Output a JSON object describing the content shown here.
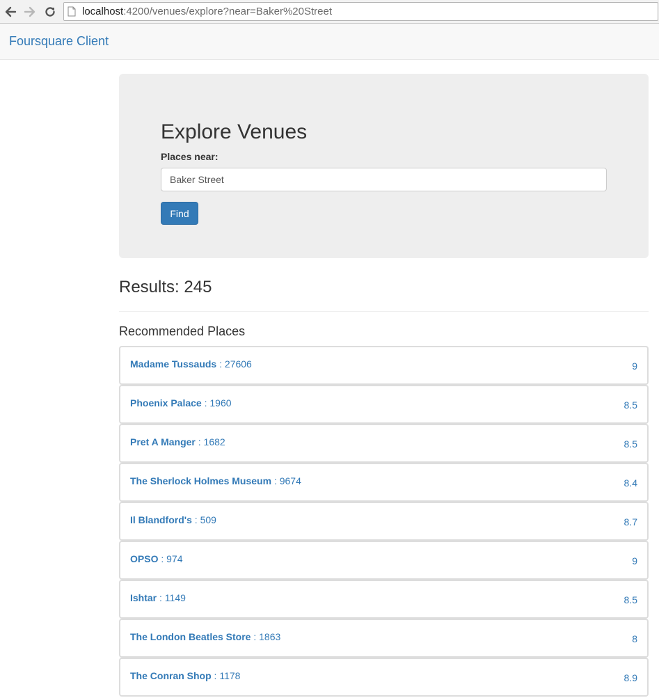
{
  "browser": {
    "url_host": "localhost",
    "url_rest": ":4200/venues/explore?near=Baker%20Street"
  },
  "navbar": {
    "brand": "Foursquare Client"
  },
  "explore": {
    "title": "Explore Venues",
    "field_label": "Places near:",
    "input_value": "Baker Street",
    "find_label": "Find"
  },
  "results": {
    "label": "Results: ",
    "count": "245",
    "section_title": "Recommended Places"
  },
  "venues": [
    {
      "name": "Madame Tussauds",
      "sep": " : ",
      "checkins": "27606",
      "rating": "9"
    },
    {
      "name": "Phoenix Palace",
      "sep": " : ",
      "checkins": "1960",
      "rating": "8.5"
    },
    {
      "name": "Pret A Manger",
      "sep": " : ",
      "checkins": "1682",
      "rating": "8.5"
    },
    {
      "name": "The Sherlock Holmes Museum",
      "sep": " : ",
      "checkins": "9674",
      "rating": "8.4"
    },
    {
      "name": "Il Blandford's",
      "sep": " : ",
      "checkins": "509",
      "rating": "8.7"
    },
    {
      "name": "OPSO",
      "sep": " : ",
      "checkins": "974",
      "rating": "9"
    },
    {
      "name": "Ishtar",
      "sep": " : ",
      "checkins": "1149",
      "rating": "8.5"
    },
    {
      "name": "The London Beatles Store",
      "sep": " : ",
      "checkins": "1863",
      "rating": "8"
    },
    {
      "name": "The Conran Shop",
      "sep": " : ",
      "checkins": "1178",
      "rating": "8.9"
    }
  ],
  "colors": {
    "brand": "#337ab7",
    "primary_button": "#337ab7",
    "jumbotron_bg": "#eeeeee",
    "navbar_bg": "#f8f8f8"
  },
  "icons": {
    "back": "arrow-left-icon",
    "forward": "arrow-right-icon",
    "reload": "reload-icon",
    "page": "page-icon"
  }
}
